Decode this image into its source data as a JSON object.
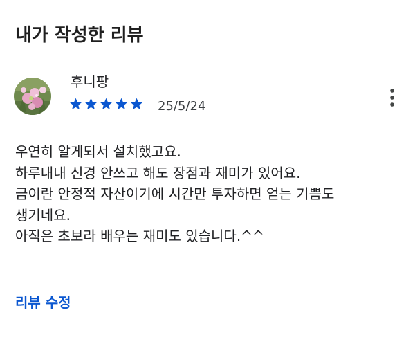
{
  "page": {
    "title": "내가 작성한 리뷰"
  },
  "review": {
    "author": "후니팡",
    "avatar_icon": "flower-photo-avatar",
    "rating": 5,
    "rating_max": 5,
    "star_color": "#0b57d0",
    "date": "25/5/24",
    "menu_icon": "more-vert-icon",
    "body_lines": [
      "우연히 알게되서 설치했고요.",
      "하루내내 신경 안쓰고 해도 장점과 재미가 있어요.",
      "금이란 안정적 자산이기에 시간만 투자하면 얻는 기쁨도",
      "생기네요.",
      "아직은 초보라 배우는 재미도 있습니다.^^"
    ]
  },
  "actions": {
    "edit_label": "리뷰 수정",
    "accent_color": "#0b57d0"
  }
}
